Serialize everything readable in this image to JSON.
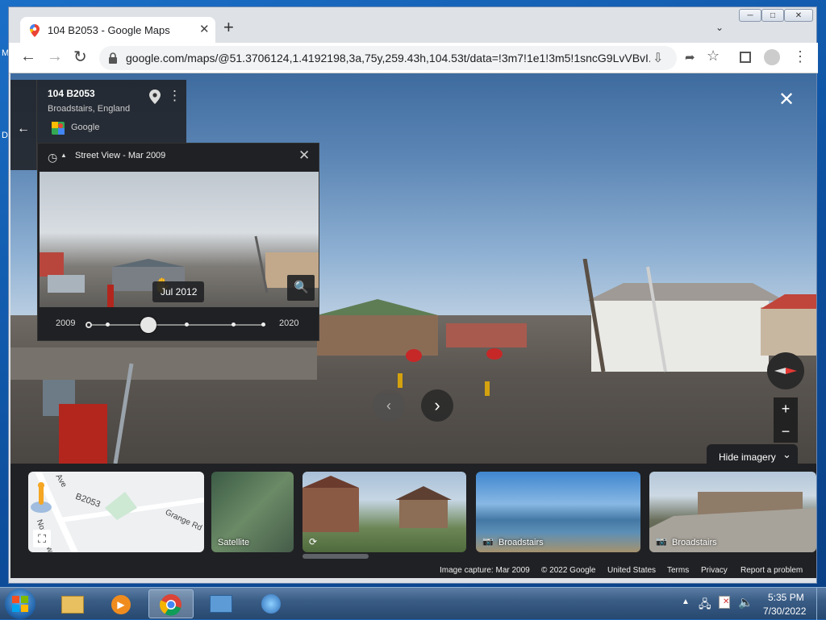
{
  "browser": {
    "tab_title": "104 B2053 - Google Maps",
    "url": "google.com/maps/@51.3706124,1.4192198,3a,75y,259.43h,104.53t/data=!3m7!1e1!3m5!1sncG9LvVBvI..."
  },
  "place_card": {
    "title": "104 B2053",
    "subtitle": "Broadstairs, England",
    "source": "Google"
  },
  "time_machine": {
    "header": "Street View - Mar 2009",
    "tooltip": "Jul 2012",
    "year_start": "2009",
    "year_end": "2020",
    "slider_fraction": 0.34
  },
  "controls": {
    "hide_imagery": "Hide imagery"
  },
  "minimap": {
    "roads": [
      "Ave",
      "B2053",
      "Grange Rd",
      "Northdown Rd"
    ]
  },
  "thumbnails": [
    {
      "label": "Satellite"
    },
    {
      "label": ""
    },
    {
      "label": "Broadstairs"
    },
    {
      "label": "Broadstairs"
    }
  ],
  "footer": {
    "capture": "Image capture: Mar 2009",
    "copyright": "© 2022 Google",
    "country": "United States",
    "terms": "Terms",
    "privacy": "Privacy",
    "report": "Report a problem"
  },
  "taskbar": {
    "time": "5:35 PM",
    "date": "7/30/2022"
  },
  "colors": {
    "accent": "#1a73e8",
    "panel": "#202124",
    "taskbar": "#2f527c"
  }
}
